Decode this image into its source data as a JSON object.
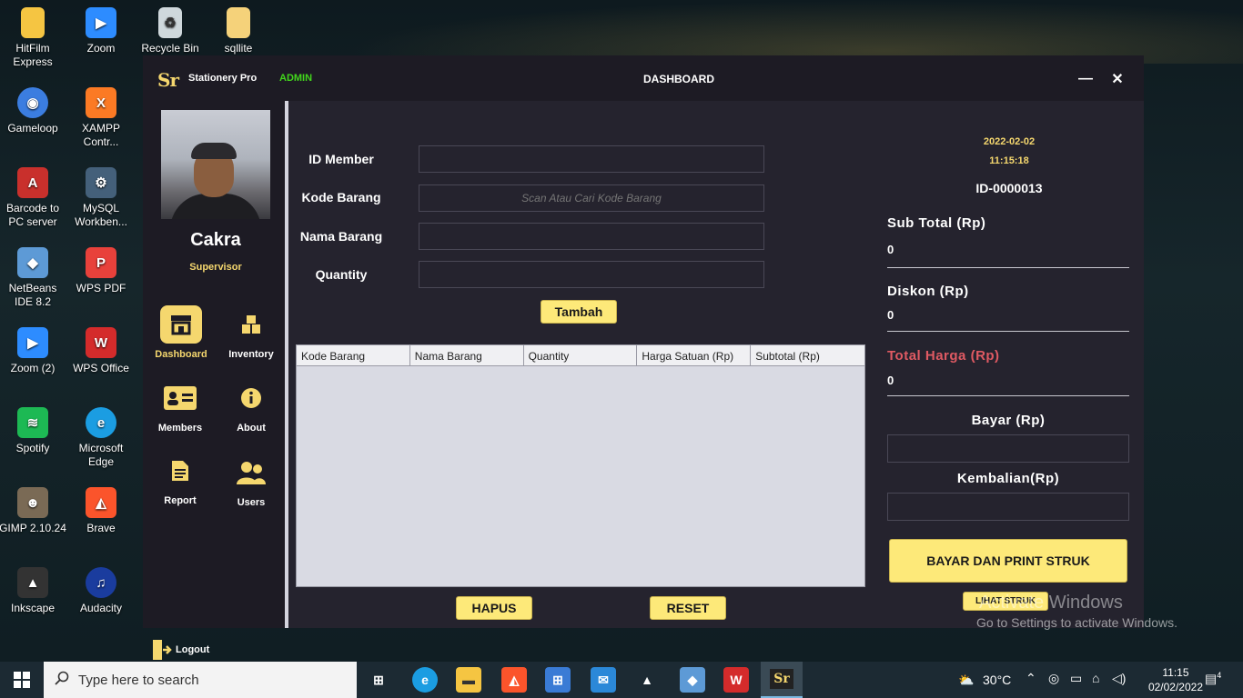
{
  "desktop": {
    "icons": [
      {
        "label": "HitFilm\nExpress",
        "short": "HitFilm Express"
      },
      {
        "label": "Zoom"
      },
      {
        "label": "Recycle Bin"
      },
      {
        "label": "sqllite"
      },
      {
        "label": "Gameloop"
      },
      {
        "label": "XAMPP Contr..."
      },
      {
        "label": "Barcode to PC server"
      },
      {
        "label": "MySQL Workben..."
      },
      {
        "label": "NetBeans IDE 8.2"
      },
      {
        "label": "WPS PDF"
      },
      {
        "label": "Zoom (2)"
      },
      {
        "label": "WPS Office"
      },
      {
        "label": "Spotify"
      },
      {
        "label": "Microsoft Edge"
      },
      {
        "label": "GIMP 2.10.24"
      },
      {
        "label": "Brave"
      },
      {
        "label": "Inkscape"
      },
      {
        "label": "Audacity"
      }
    ]
  },
  "app": {
    "logo": "Sr",
    "name": "Stationery Pro",
    "role_badge": "ADMIN",
    "title": "DASHBOARD",
    "minimize": "—",
    "close": "✕"
  },
  "sidebar": {
    "user_name": "Cakra",
    "user_role": "Supervisor",
    "nav": [
      {
        "label": "Dashboard",
        "icon": "store-icon",
        "active": true
      },
      {
        "label": "Inventory",
        "icon": "boxes-icon"
      },
      {
        "label": "Members",
        "icon": "id-card-icon"
      },
      {
        "label": "About",
        "icon": "info-icon"
      },
      {
        "label": "Report",
        "icon": "document-icon"
      },
      {
        "label": "Users",
        "icon": "users-icon"
      }
    ],
    "logout": "Logout"
  },
  "form": {
    "id_member_label": "ID Member",
    "kode_barang_label": "Kode Barang",
    "kode_barang_placeholder": "Scan Atau Cari Kode Barang",
    "nama_barang_label": "Nama Barang",
    "quantity_label": "Quantity",
    "tambah": "Tambah"
  },
  "table": {
    "columns": [
      "Kode Barang",
      "Nama Barang",
      "Quantity",
      "Harga Satuan (Rp)",
      "Subtotal (Rp)"
    ],
    "rows": []
  },
  "actions": {
    "hapus": "HAPUS",
    "reset": "RESET",
    "bayar": "BAYAR DAN PRINT STRUK",
    "lihat": "LIHAT STRUK"
  },
  "summary": {
    "date": "2022-02-02",
    "time": "11:15:18",
    "transaction_id": "ID-0000013",
    "subtotal_label": "Sub Total (Rp)",
    "subtotal_value": "0",
    "diskon_label": "Diskon (Rp)",
    "diskon_value": "0",
    "total_label": "Total Harga (Rp)",
    "total_value": "0",
    "bayar_label": "Bayar (Rp)",
    "kembalian_label": "Kembalian(Rp)"
  },
  "watermark": {
    "line1": "Activate Windows",
    "line2": "Go to Settings to activate Windows."
  },
  "taskbar": {
    "search_placeholder": "Type here to search",
    "weather": "30°C",
    "time": "11:15",
    "date": "02/02/2022",
    "notifications": "4"
  },
  "colors": {
    "accent": "#f5d76e",
    "button": "#fde979",
    "panel": "#25232e",
    "sidebar": "#1d1b24",
    "admin": "#42d61c",
    "total": "#e05a63"
  }
}
